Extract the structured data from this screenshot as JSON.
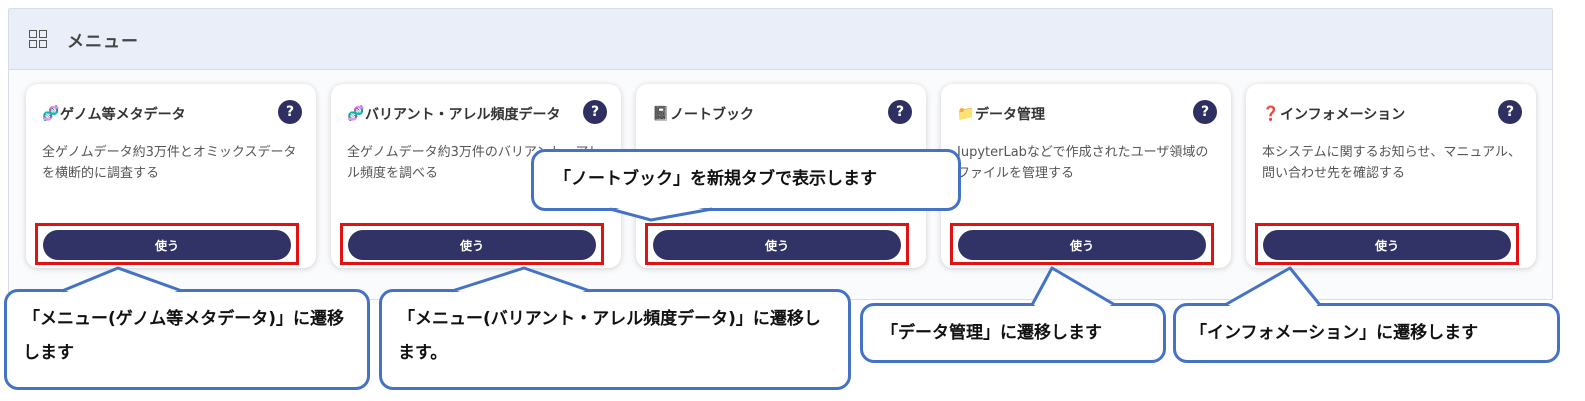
{
  "header": {
    "icon": "grid-icon",
    "title": "メニュー"
  },
  "cards": [
    {
      "icon": "dna-icon",
      "icon_glyph": "🧬",
      "icon_color": "#9b4dca",
      "title": "ゲノム等メタデータ",
      "help": "?",
      "desc": "全ゲノムデータ約3万件とオミックスデータを横断的に調査する",
      "button": "使う"
    },
    {
      "icon": "dna-icon",
      "icon_glyph": "🧬",
      "icon_color": "#9b4dca",
      "title": "バリアント・アレル頻度データ",
      "help": "?",
      "desc": "全ゲノムデータ約3万件のバリアント・アレル頻度を調べる",
      "button": "使う"
    },
    {
      "icon": "notebook-icon",
      "icon_glyph": "📓",
      "icon_color": "#6b2e5a",
      "title": "ノートブック",
      "help": "?",
      "desc": "",
      "button": "使う"
    },
    {
      "icon": "folder-icon",
      "icon_glyph": "📁",
      "icon_color": "#f0b429",
      "title": "データ管理",
      "help": "?",
      "desc": "JupyterLabなどで作成されたユーザ領域のファイルを管理する",
      "button": "使う"
    },
    {
      "icon": "question-icon",
      "icon_glyph": "❓",
      "icon_color": "#d9304a",
      "title": "インフォメーション",
      "help": "?",
      "desc": "本システムに関するお知らせ、マニュアル、問い合わせ先を確認する",
      "button": "使う"
    }
  ],
  "callouts": {
    "c1": "「メニュー(ゲノム等メタデータ)」に遷移します",
    "c2": "「メニュー(バリアント・アレル頻度データ)」に遷移します。",
    "c3": "「ノートブック」を新規タブで表示します",
    "c4": "「データ管理」に遷移します",
    "c5": "「インフォメーション」に遷移します"
  },
  "colors": {
    "accent": "#313265",
    "highlight": "#e31212",
    "callout_border": "#4472c4",
    "header_bg": "#e9eef8"
  }
}
